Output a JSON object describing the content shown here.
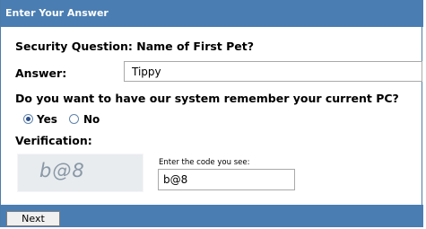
{
  "header": {
    "title": "Enter Your Answer"
  },
  "security_question": {
    "label": "Security Question: Name of First Pet?"
  },
  "answer": {
    "label": "Answer:",
    "value": "Tippy"
  },
  "remember_pc": {
    "question": "Do you want to have our system remember your current PC?",
    "options": [
      {
        "label": "Yes",
        "selected": true
      },
      {
        "label": "No",
        "selected": false
      }
    ]
  },
  "verification": {
    "label": "Verification:",
    "captcha_image_text": "b@8",
    "hint": "Enter the code you see:",
    "code_value": "b@8"
  },
  "footer": {
    "next_label": "Next"
  },
  "colors": {
    "accent": "#4a7db2"
  }
}
